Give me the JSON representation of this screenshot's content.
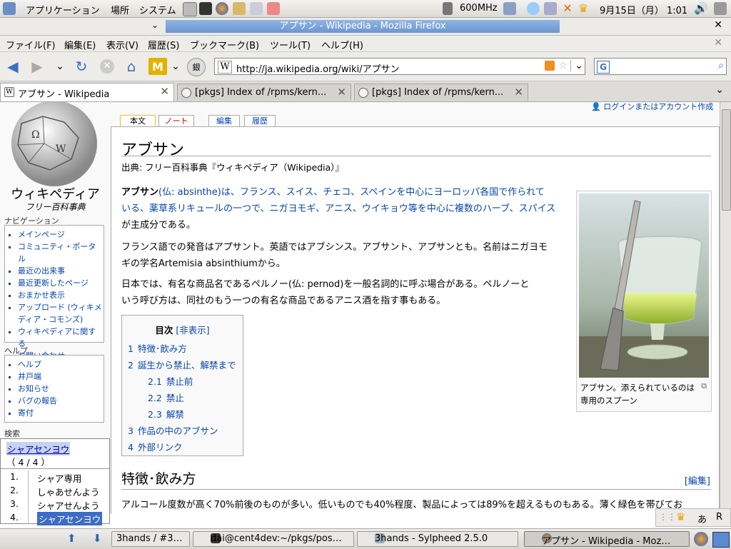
{
  "top_panel": {
    "menus": [
      "アプリケーション",
      "場所",
      "システム"
    ],
    "cpu_freq": "600MHz",
    "clock": "9月15日（月） 1:01"
  },
  "window": {
    "title": "アプサン - Wikipedia - Mozilla Firefox"
  },
  "menubar": [
    "ファイル(F)",
    "編集(E)",
    "表示(V)",
    "履歴(S)",
    "ブックマーク(B)",
    "ツール(T)",
    "ヘルプ(H)"
  ],
  "navbar": {
    "url": "http://ja.wikipedia.org/wiki/アプサン",
    "search_value": ""
  },
  "tabs": [
    {
      "label": "アブサン - Wikipedia"
    },
    {
      "label": "[pkgs] Index of /rpms/kern..."
    },
    {
      "label": "[pkgs] Index of /rpms/kern..."
    }
  ],
  "page": {
    "login": "ログインまたはアカウント作成",
    "content_tabs": [
      "本文",
      "ノート",
      "編集",
      "履歴"
    ],
    "logo_title": "ウィキペディア",
    "logo_subtitle": "フリー百科事典",
    "nav_heading": "ナビゲーション",
    "nav_items": [
      "メインページ",
      "コミュニティ・ポータル",
      "最近の出来事",
      "最近更新したページ",
      "おまかせ表示",
      "アップロード (ウィキメ",
      "ディア・コモンズ)",
      "ウィキペディアに関する",
      "お問い合わせ"
    ],
    "help_heading": "ヘルプ",
    "help_items": [
      "ヘルプ",
      "井戸端",
      "お知らせ",
      "バグの報告",
      "寄付"
    ],
    "search_heading": "検索",
    "title": "アブサン",
    "from": "出典: フリー百科事典『ウィキペディア（Wikipedia）』",
    "p1_line1": "(仏: absinthe)は、フランス、スイス、チェコ、スペインを中心にヨーロッパ各国で作られて",
    "p1_bold": "アブサン",
    "p1_line2": "いる、薬草系リキュールの一つで、ニガヨモギ、アニス、ウイキョウ等を中心に複数のハーブ、スパイス",
    "p1_line3": "が主成分である。",
    "p2_line1": "フランス語での発音はアプサント。英語ではアブシンス。アブサント、アプサンとも。名前はニガヨモ",
    "p2_line2": "ギの学名Artemisia absinthiumから。",
    "p3_line1": "日本では、有名な商品名であるペルノー(仏: pernod)を一般名詞的に呼ぶ場合がある。ペルノーと",
    "p3_line2": "いう呼び方は、同社のもう一つの有名な商品であるアニス酒を指す事もある。",
    "toc_title": "目次",
    "toc_hide": "[非表示]",
    "toc": [
      {
        "num": "1",
        "text": "特徴･飲み方",
        "level": 1
      },
      {
        "num": "2",
        "text": "誕生から禁止、解禁まで",
        "level": 1
      },
      {
        "num": "2.1",
        "text": "禁止前",
        "level": 2
      },
      {
        "num": "2.2",
        "text": "禁止",
        "level": 2
      },
      {
        "num": "2.3",
        "text": "解禁",
        "level": 2
      },
      {
        "num": "3",
        "text": "作品の中のアブサン",
        "level": 1
      },
      {
        "num": "4",
        "text": "外部リンク",
        "level": 1
      }
    ],
    "thumb_caption": "アブサン。添えられているのは専用のスプーン",
    "section_heading": "特徴･飲み方",
    "edit_link": "[編集]",
    "section_p1": "アルコール度数が高く70%前後のものが多い。低いものでも40%程度、製品によっては89%を超えるものもある。薄く緑色を帯びてお"
  },
  "ime": {
    "query": "シャアセンヨウ",
    "count": "（ 4 / 4 ）",
    "candidates": [
      {
        "num": "1.",
        "text": "シャア専用"
      },
      {
        "num": "2.",
        "text": "しゃあせんよう"
      },
      {
        "num": "3.",
        "text": "シャアせんよう"
      },
      {
        "num": "4.",
        "text": "シャアセンヨウ"
      }
    ],
    "status": [
      "あ",
      "R"
    ]
  },
  "taskbar": [
    {
      "label": "3hands / #3…"
    },
    {
      "label": "dai@cent4dev:~/pkgs/pos…"
    },
    {
      "label": "3hands - Sylpheed 2.5.0"
    },
    {
      "label": "アプサン - Wikipedia - Moz…"
    }
  ]
}
